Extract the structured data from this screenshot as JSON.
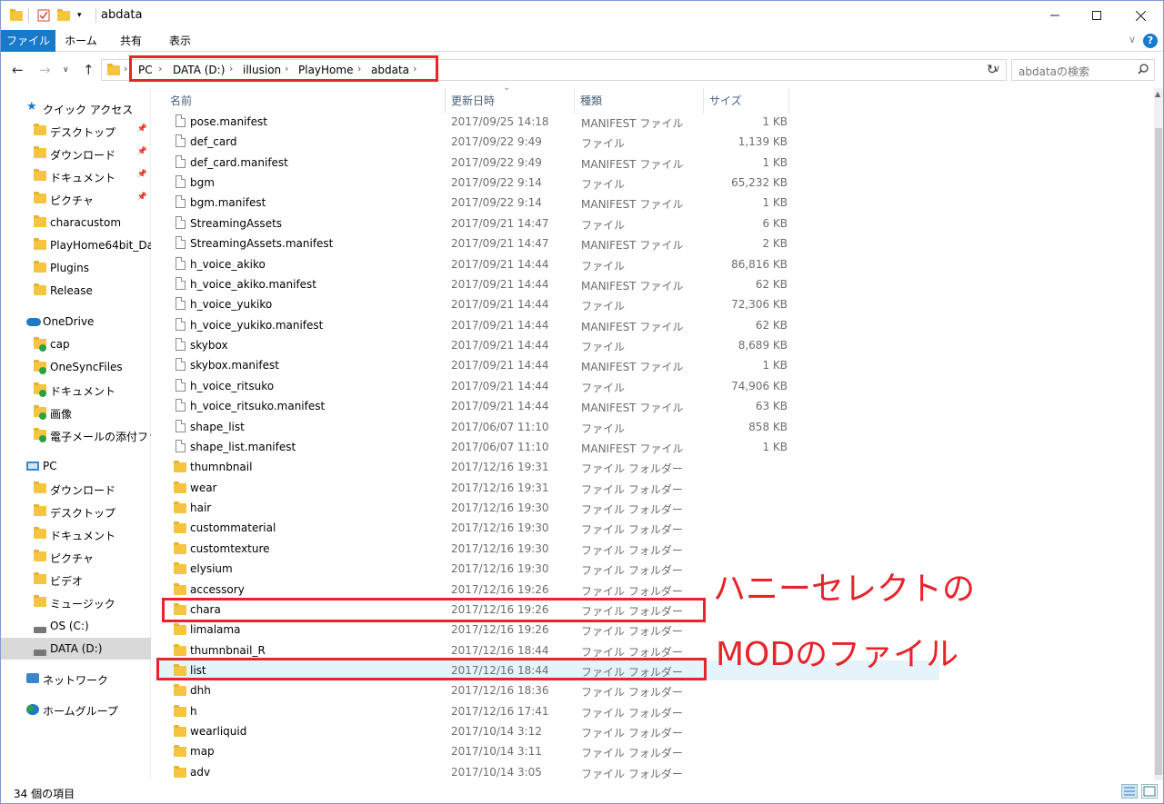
{
  "window": {
    "title": "abdata"
  },
  "ribbon": {
    "tabs": [
      "ファイル",
      "ホーム",
      "共有",
      "表示"
    ],
    "help": "?"
  },
  "address": {
    "crumbs": [
      "PC",
      "DATA (D:)",
      "illusion",
      "PlayHome",
      "abdata"
    ]
  },
  "search": {
    "placeholder": "abdataの検索"
  },
  "nav": {
    "quick_access": "クイック アクセス",
    "quick_items": [
      "デスクトップ",
      "ダウンロード",
      "ドキュメント",
      "ピクチャ",
      "characustom",
      "PlayHome64bit_Data",
      "Plugins",
      "Release"
    ],
    "onedrive": "OneDrive",
    "onedrive_items": [
      "cap",
      "OneSyncFiles",
      "ドキュメント",
      "画像",
      "電子メールの添付ファイル"
    ],
    "pc": "PC",
    "pc_items": [
      "ダウンロード",
      "デスクトップ",
      "ドキュメント",
      "ピクチャ",
      "ビデオ",
      "ミュージック",
      "OS (C:)",
      "DATA (D:)"
    ],
    "network": "ネットワーク",
    "homegroup": "ホームグループ"
  },
  "columns": {
    "name": "名前",
    "date": "更新日時",
    "type": "種類",
    "size": "サイズ"
  },
  "files": [
    {
      "name": "pose.manifest",
      "date": "2017/09/25 14:18",
      "type": "MANIFEST ファイル",
      "size": "1 KB",
      "kind": "file"
    },
    {
      "name": "def_card",
      "date": "2017/09/22 9:49",
      "type": "ファイル",
      "size": "1,139 KB",
      "kind": "file"
    },
    {
      "name": "def_card.manifest",
      "date": "2017/09/22 9:49",
      "type": "MANIFEST ファイル",
      "size": "1 KB",
      "kind": "file"
    },
    {
      "name": "bgm",
      "date": "2017/09/22 9:14",
      "type": "ファイル",
      "size": "65,232 KB",
      "kind": "file"
    },
    {
      "name": "bgm.manifest",
      "date": "2017/09/22 9:14",
      "type": "MANIFEST ファイル",
      "size": "1 KB",
      "kind": "file"
    },
    {
      "name": "StreamingAssets",
      "date": "2017/09/21 14:47",
      "type": "ファイル",
      "size": "6 KB",
      "kind": "file"
    },
    {
      "name": "StreamingAssets.manifest",
      "date": "2017/09/21 14:47",
      "type": "MANIFEST ファイル",
      "size": "2 KB",
      "kind": "file"
    },
    {
      "name": "h_voice_akiko",
      "date": "2017/09/21 14:44",
      "type": "ファイル",
      "size": "86,816 KB",
      "kind": "file"
    },
    {
      "name": "h_voice_akiko.manifest",
      "date": "2017/09/21 14:44",
      "type": "MANIFEST ファイル",
      "size": "62 KB",
      "kind": "file"
    },
    {
      "name": "h_voice_yukiko",
      "date": "2017/09/21 14:44",
      "type": "ファイル",
      "size": "72,306 KB",
      "kind": "file"
    },
    {
      "name": "h_voice_yukiko.manifest",
      "date": "2017/09/21 14:44",
      "type": "MANIFEST ファイル",
      "size": "62 KB",
      "kind": "file"
    },
    {
      "name": "skybox",
      "date": "2017/09/21 14:44",
      "type": "ファイル",
      "size": "8,689 KB",
      "kind": "file"
    },
    {
      "name": "skybox.manifest",
      "date": "2017/09/21 14:44",
      "type": "MANIFEST ファイル",
      "size": "1 KB",
      "kind": "file"
    },
    {
      "name": "h_voice_ritsuko",
      "date": "2017/09/21 14:44",
      "type": "ファイル",
      "size": "74,906 KB",
      "kind": "file"
    },
    {
      "name": "h_voice_ritsuko.manifest",
      "date": "2017/09/21 14:44",
      "type": "MANIFEST ファイル",
      "size": "63 KB",
      "kind": "file"
    },
    {
      "name": "shape_list",
      "date": "2017/06/07 11:10",
      "type": "ファイル",
      "size": "858 KB",
      "kind": "file"
    },
    {
      "name": "shape_list.manifest",
      "date": "2017/06/07 11:10",
      "type": "MANIFEST ファイル",
      "size": "1 KB",
      "kind": "file"
    },
    {
      "name": "thumnbnail",
      "date": "2017/12/16 19:31",
      "type": "ファイル フォルダー",
      "size": "",
      "kind": "folder"
    },
    {
      "name": "wear",
      "date": "2017/12/16 19:31",
      "type": "ファイル フォルダー",
      "size": "",
      "kind": "folder"
    },
    {
      "name": "hair",
      "date": "2017/12/16 19:30",
      "type": "ファイル フォルダー",
      "size": "",
      "kind": "folder"
    },
    {
      "name": "custommaterial",
      "date": "2017/12/16 19:30",
      "type": "ファイル フォルダー",
      "size": "",
      "kind": "folder"
    },
    {
      "name": "customtexture",
      "date": "2017/12/16 19:30",
      "type": "ファイル フォルダー",
      "size": "",
      "kind": "folder"
    },
    {
      "name": "elysium",
      "date": "2017/12/16 19:30",
      "type": "ファイル フォルダー",
      "size": "",
      "kind": "folder"
    },
    {
      "name": "accessory",
      "date": "2017/12/16 19:26",
      "type": "ファイル フォルダー",
      "size": "",
      "kind": "folder"
    },
    {
      "name": "chara",
      "date": "2017/12/16 19:26",
      "type": "ファイル フォルダー",
      "size": "",
      "kind": "folder"
    },
    {
      "name": "limalama",
      "date": "2017/12/16 19:26",
      "type": "ファイル フォルダー",
      "size": "",
      "kind": "folder"
    },
    {
      "name": "thumnbnail_R",
      "date": "2017/12/16 18:44",
      "type": "ファイル フォルダー",
      "size": "",
      "kind": "folder"
    },
    {
      "name": "list",
      "date": "2017/12/16 18:44",
      "type": "ファイル フォルダー",
      "size": "",
      "kind": "folder"
    },
    {
      "name": "dhh",
      "date": "2017/12/16 18:36",
      "type": "ファイル フォルダー",
      "size": "",
      "kind": "folder"
    },
    {
      "name": "h",
      "date": "2017/12/16 17:41",
      "type": "ファイル フォルダー",
      "size": "",
      "kind": "folder"
    },
    {
      "name": "wearliquid",
      "date": "2017/10/14 3:12",
      "type": "ファイル フォルダー",
      "size": "",
      "kind": "folder"
    },
    {
      "name": "map",
      "date": "2017/10/14 3:11",
      "type": "ファイル フォルダー",
      "size": "",
      "kind": "folder"
    },
    {
      "name": "adv",
      "date": "2017/10/14 3:05",
      "type": "ファイル フォルダー",
      "size": "",
      "kind": "folder"
    }
  ],
  "annotations": {
    "line1": "ハニーセレクトの",
    "line2": "MODのファイル"
  },
  "status": {
    "count": "34 個の項目"
  },
  "colors": {
    "accent": "#1979ca",
    "highlight": "#e8232a",
    "selected_row": "#e5f3fb"
  }
}
